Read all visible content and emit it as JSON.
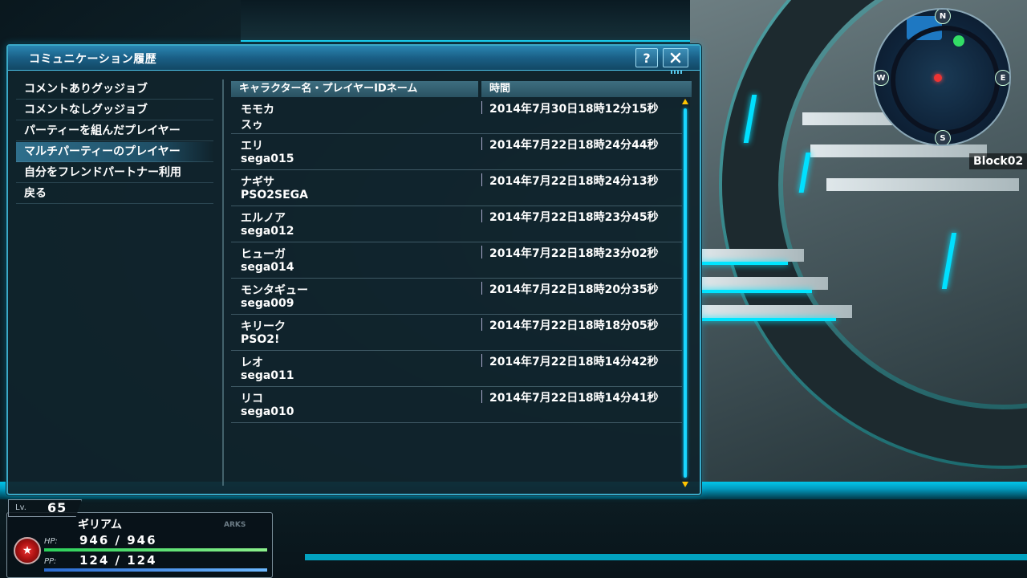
{
  "window": {
    "title": "コミュニケーション履歴",
    "help_label": "?"
  },
  "menu": {
    "items": [
      {
        "label": "コメントありグッジョブ",
        "active": false
      },
      {
        "label": "コメントなしグッジョブ",
        "active": false
      },
      {
        "label": "パーティーを組んだプレイヤー",
        "active": false
      },
      {
        "label": "マルチパーティーのプレイヤー",
        "active": true
      },
      {
        "label": "自分をフレンドパートナー利用",
        "active": false
      },
      {
        "label": "戻る",
        "active": false
      }
    ]
  },
  "list": {
    "headers": {
      "name": "キャラクター名・プレイヤーIDネーム",
      "time": "時間"
    },
    "rows": [
      {
        "name": "モモカ",
        "player_id": "スゥ",
        "time": "2014年7月30日18時12分15秒"
      },
      {
        "name": "エリ",
        "player_id": "sega015",
        "time": "2014年7月22日18時24分44秒"
      },
      {
        "name": "ナギサ",
        "player_id": "PSO2SEGA",
        "time": "2014年7月22日18時24分13秒"
      },
      {
        "name": "エルノア",
        "player_id": "sega012",
        "time": "2014年7月22日18時23分45秒"
      },
      {
        "name": "ヒューガ",
        "player_id": "sega014",
        "time": "2014年7月22日18時23分02秒"
      },
      {
        "name": "モンタギュー",
        "player_id": "sega009",
        "time": "2014年7月22日18時20分35秒"
      },
      {
        "name": "キリーク",
        "player_id": "PSO2!",
        "time": "2014年7月22日18時18分05秒"
      },
      {
        "name": "レオ",
        "player_id": "sega011",
        "time": "2014年7月22日18時14分42秒"
      },
      {
        "name": "リコ",
        "player_id": "sega010",
        "time": "2014年7月22日18時14分41秒"
      }
    ]
  },
  "minimap": {
    "compass": {
      "n": "N",
      "s": "S",
      "e": "E",
      "w": "W"
    },
    "block": "Block02"
  },
  "status": {
    "level_label": "Lv.",
    "level": "65",
    "name": "ギリアム",
    "arks": "ARKS",
    "hp_label": "HP:",
    "hp": "946 /  946",
    "hp_ratio": 1.0,
    "pp_label": "PP:",
    "pp": "124 /  124",
    "pp_ratio": 1.0
  },
  "colors": {
    "accent": "#1ad6ff",
    "title_bar": "#1a5f86",
    "scroll_arrow": "#ffc400"
  }
}
